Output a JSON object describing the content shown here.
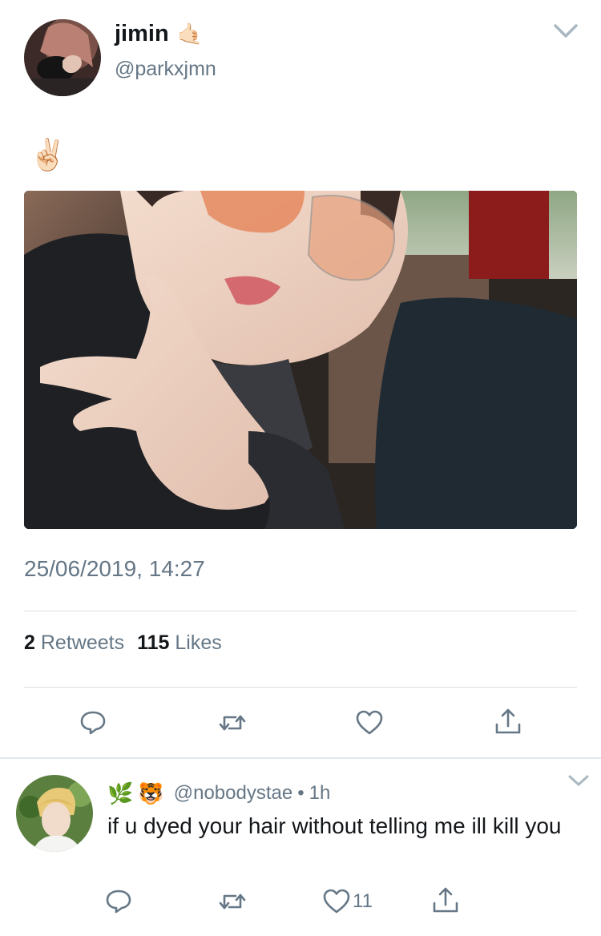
{
  "tweet": {
    "display_name": "jimin",
    "name_emoji": "🤙🏻",
    "handle": "@parkxjmn",
    "text": "✌🏻",
    "timestamp": "25/06/2019, 14:27",
    "retweets_count": "2",
    "retweets_label": "Retweets",
    "likes_count": "115",
    "likes_label": "Likes",
    "icons": {
      "more": "chevron-down-icon",
      "reply": "reply-icon",
      "retweet": "retweet-icon",
      "like": "heart-icon",
      "share": "share-icon"
    }
  },
  "reply": {
    "emojis": [
      "🌿",
      "🐯"
    ],
    "handle": "@nobodystae",
    "separator": "•",
    "time": "1h",
    "text": "if u dyed your hair without telling me ill kill you",
    "likes_count": "11"
  },
  "colors": {
    "text_primary": "#14171a",
    "text_secondary": "#657786",
    "divider": "#d9dfe3",
    "icon": "#657786"
  }
}
